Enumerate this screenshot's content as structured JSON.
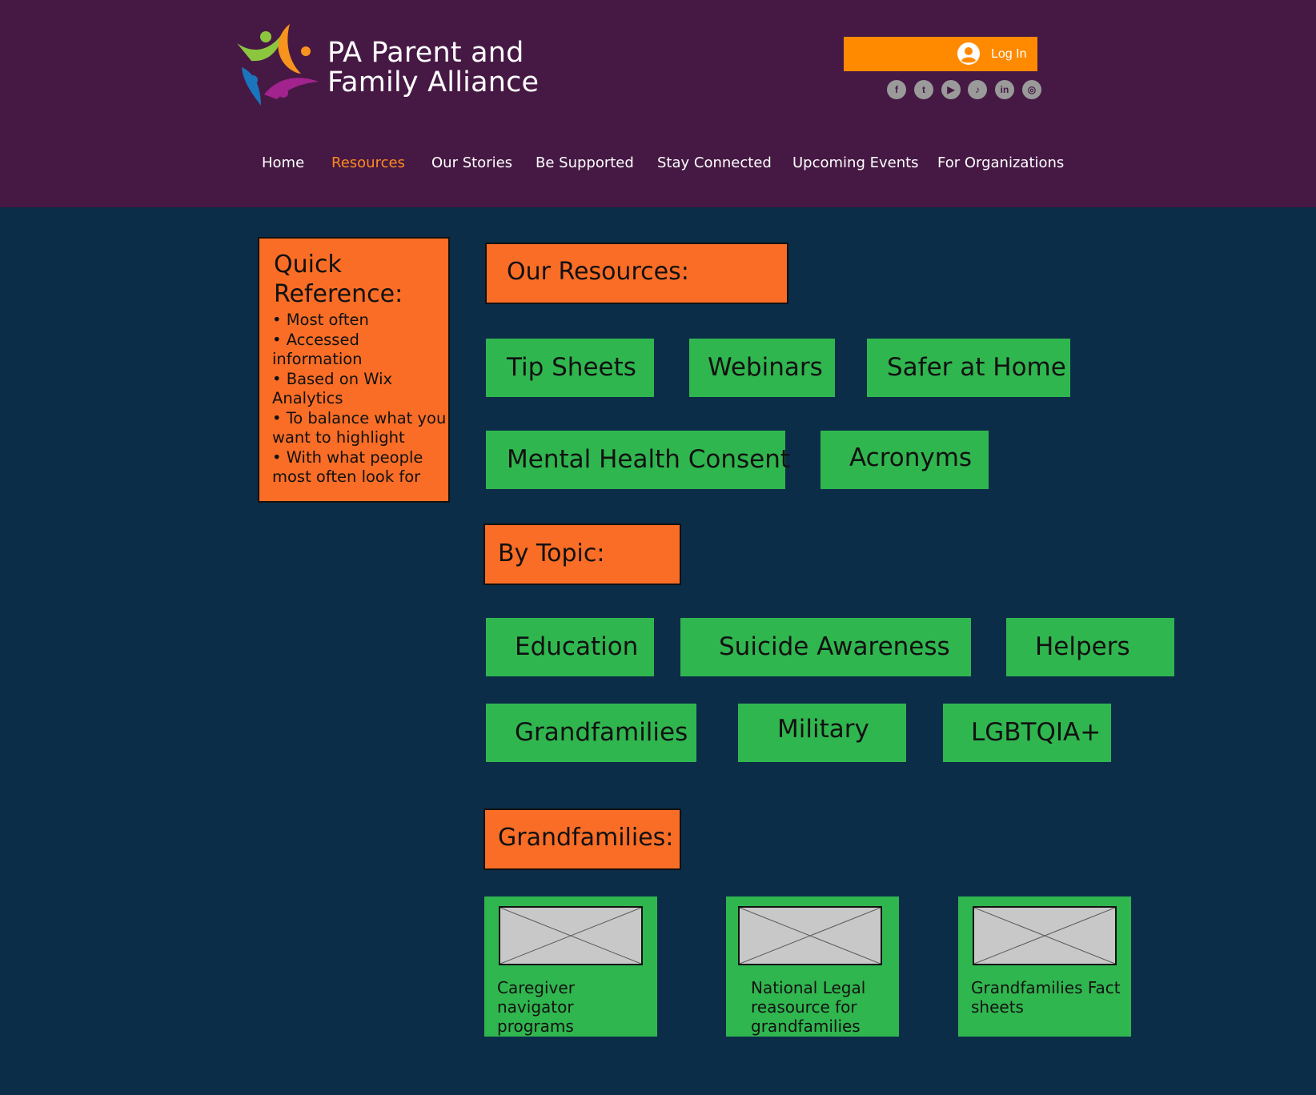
{
  "brand": {
    "line1": "PA Parent and",
    "line2": "Family Alliance"
  },
  "login": {
    "label": "Log In"
  },
  "social": [
    {
      "icon": "facebook-icon",
      "glyph": "f"
    },
    {
      "icon": "twitter-icon",
      "glyph": "t"
    },
    {
      "icon": "youtube-icon",
      "glyph": "▶"
    },
    {
      "icon": "tiktok-icon",
      "glyph": "♪"
    },
    {
      "icon": "linkedin-icon",
      "glyph": "in"
    },
    {
      "icon": "instagram-icon",
      "glyph": "◎"
    }
  ],
  "nav": {
    "items": [
      "Home",
      "Resources",
      "Our Stories",
      "Be Supported",
      "Stay Connected",
      "Upcoming Events",
      "For Organizations"
    ],
    "active": "Resources"
  },
  "quick_reference": {
    "title": "Quick Reference:",
    "bullets": [
      "• Most often",
      "• Accessed information",
      "• Based on Wix Analytics",
      "• To balance what you want to highlight",
      "• With what people most often look for"
    ]
  },
  "our_resources": {
    "heading": "Our Resources:",
    "buttons": [
      "Tip Sheets",
      "Webinars",
      "Safer at Home",
      "Mental Health Consent",
      "Acronyms"
    ]
  },
  "by_topic": {
    "heading": "By Topic:",
    "buttons": [
      "Education",
      "Suicide Awareness",
      "Helpers",
      "Grandfamilies",
      "Military",
      "LGBTQIA+"
    ]
  },
  "grandfamilies": {
    "heading": "Grandfamilies:",
    "cards": [
      "Caregiver navigator programs",
      "National Legal reasource for grandfamilies",
      "Grandfamilies Fact sheets"
    ]
  },
  "colors": {
    "header_bg": "#461944",
    "page_bg": "#0b2d47",
    "orange": "#f96d26",
    "login_orange": "#ff8a00",
    "green": "#30b64f",
    "nav_active": "#ff8a1f"
  }
}
